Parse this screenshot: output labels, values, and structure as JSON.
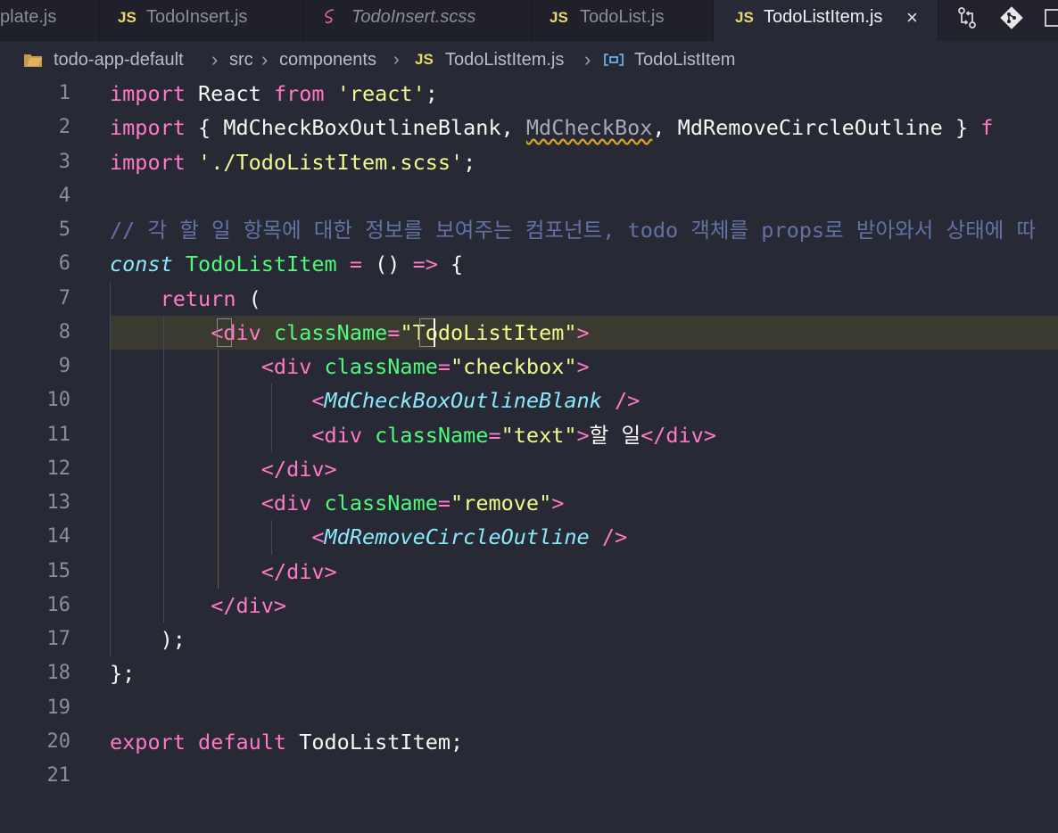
{
  "tabs": [
    {
      "icon": "",
      "label": "plate.js",
      "active": false
    },
    {
      "icon": "JS",
      "label": "TodoInsert.js",
      "active": false
    },
    {
      "icon": "sass-icon",
      "label": "TodoInsert.scss",
      "active": false
    },
    {
      "icon": "JS",
      "label": "TodoList.js",
      "active": false
    },
    {
      "icon": "JS",
      "label": "TodoListItem.js",
      "active": true,
      "close": "×"
    }
  ],
  "breadcrumb": {
    "folder": "todo-app-default",
    "src": "src",
    "components": "components",
    "file_icon": "JS",
    "file": "TodoListItem.js",
    "symbol": "TodoListItem"
  },
  "editor": {
    "current_line": 8,
    "line_numbers": [
      "1",
      "2",
      "3",
      "4",
      "5",
      "6",
      "7",
      "8",
      "9",
      "10",
      "11",
      "12",
      "13",
      "14",
      "15",
      "16",
      "17",
      "18",
      "19",
      "20",
      "21"
    ],
    "lines": [
      [
        [
          "kw",
          "import"
        ],
        [
          "pl",
          " React "
        ],
        [
          "kw",
          "from"
        ],
        [
          "pl",
          " "
        ],
        [
          "str",
          "'react'"
        ],
        [
          "pl",
          ";"
        ]
      ],
      [
        [
          "kw",
          "import"
        ],
        [
          "pl",
          " { MdCheckBoxOutlineBlank, "
        ],
        [
          "warn",
          "MdCheckBox"
        ],
        [
          "pl",
          ", MdRemoveCircleOutline } "
        ],
        [
          "kw",
          "f"
        ]
      ],
      [
        [
          "kw",
          "import"
        ],
        [
          "pl",
          " "
        ],
        [
          "str",
          "'./TodoListItem.scss'"
        ],
        [
          "pl",
          ";"
        ]
      ],
      [],
      [
        [
          "com",
          "// 각 할 일 항목에 대한 정보를 보여주는 컴포넌트, todo 객체를 props로 받아와서 상태에 따"
        ]
      ],
      [
        [
          "storage",
          "const"
        ],
        [
          "pl",
          " "
        ],
        [
          "fn",
          "TodoListItem"
        ],
        [
          "pl",
          " "
        ],
        [
          "kw",
          "="
        ],
        [
          "pl",
          " () "
        ],
        [
          "kw",
          "=>"
        ],
        [
          "pl",
          " {"
        ]
      ],
      [
        [
          "pl",
          "    "
        ],
        [
          "kw",
          "return"
        ],
        [
          "pl",
          " ("
        ]
      ],
      [
        [
          "pl",
          "        "
        ],
        [
          "tag",
          "<div"
        ],
        [
          "pl",
          " "
        ],
        [
          "attr",
          "className"
        ],
        [
          "kw",
          "="
        ],
        [
          "str",
          "\"TodoListItem\""
        ],
        [
          "tag",
          ">"
        ]
      ],
      [
        [
          "pl",
          "            "
        ],
        [
          "tag",
          "<div"
        ],
        [
          "pl",
          " "
        ],
        [
          "attr",
          "className"
        ],
        [
          "kw",
          "="
        ],
        [
          "str",
          "\"checkbox\""
        ],
        [
          "tag",
          ">"
        ]
      ],
      [
        [
          "pl",
          "                "
        ],
        [
          "tag",
          "<"
        ],
        [
          "comp",
          "MdCheckBoxOutlineBlank"
        ],
        [
          "pl",
          " "
        ],
        [
          "tag",
          "/>"
        ]
      ],
      [
        [
          "pl",
          "                "
        ],
        [
          "tag",
          "<div"
        ],
        [
          "pl",
          " "
        ],
        [
          "attr",
          "className"
        ],
        [
          "kw",
          "="
        ],
        [
          "str",
          "\"text\""
        ],
        [
          "tag",
          ">"
        ],
        [
          "pl",
          "할 일"
        ],
        [
          "tag",
          "</div>"
        ]
      ],
      [
        [
          "pl",
          "            "
        ],
        [
          "tag",
          "</div>"
        ]
      ],
      [
        [
          "pl",
          "            "
        ],
        [
          "tag",
          "<div"
        ],
        [
          "pl",
          " "
        ],
        [
          "attr",
          "className"
        ],
        [
          "kw",
          "="
        ],
        [
          "str",
          "\"remove\""
        ],
        [
          "tag",
          ">"
        ]
      ],
      [
        [
          "pl",
          "                "
        ],
        [
          "tag",
          "<"
        ],
        [
          "comp",
          "MdRemoveCircleOutline"
        ],
        [
          "pl",
          " "
        ],
        [
          "tag",
          "/>"
        ]
      ],
      [
        [
          "pl",
          "            "
        ],
        [
          "tag",
          "</div>"
        ]
      ],
      [
        [
          "pl",
          "        "
        ],
        [
          "tag",
          "</div>"
        ]
      ],
      [
        [
          "pl",
          "    );"
        ]
      ],
      [
        [
          "pl",
          "};"
        ]
      ],
      [],
      [
        [
          "kw",
          "export"
        ],
        [
          "pl",
          " "
        ],
        [
          "kw",
          "default"
        ],
        [
          "pl",
          " TodoListItem;"
        ]
      ],
      []
    ]
  },
  "colors": {
    "background": "#272935",
    "keyword": "#ff79c6",
    "string": "#f1fa8c",
    "comment": "#6272a4",
    "function": "#50fa7b",
    "component": "#8be9fd"
  }
}
